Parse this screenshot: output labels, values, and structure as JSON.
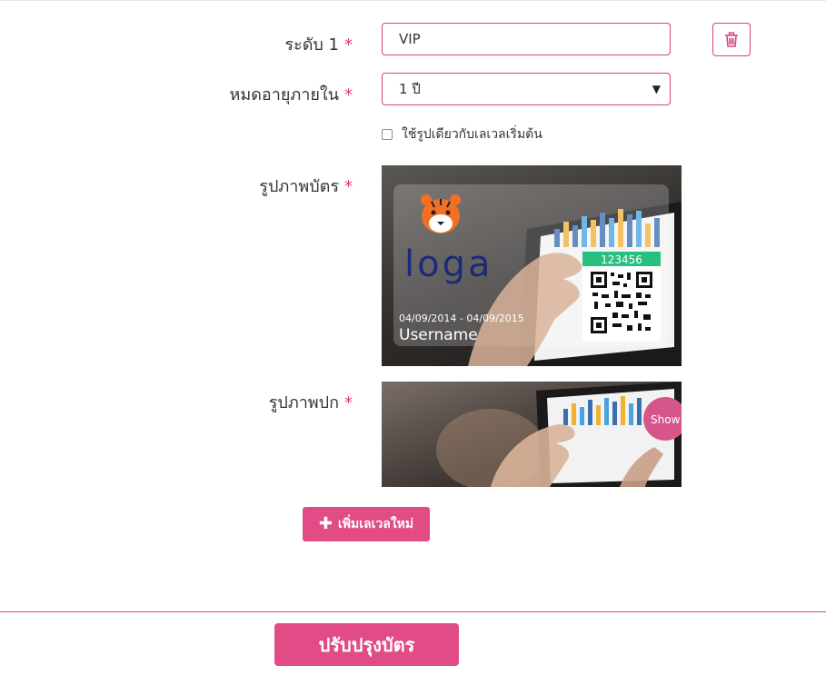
{
  "form": {
    "level": {
      "label": "ระดับ 1",
      "required_mark": "*",
      "value": "VIP"
    },
    "expiry": {
      "label": "หมดอายุภายใน",
      "required_mark": "*",
      "selected": "1 ปี"
    },
    "same_image_checkbox": {
      "label": "ใช้รูปเดียวกับเลเวลเริ่มต้น",
      "checked": false
    },
    "card_image": {
      "label": "รูปภาพบัตร",
      "required_mark": "*",
      "preview": {
        "brand": "loga",
        "member_code": "123456",
        "validity": "04/09/2014 - 04/09/2015",
        "username": "Username"
      }
    },
    "cover_image": {
      "label": "รูปภาพปก",
      "required_mark": "*",
      "tag": "Show"
    }
  },
  "actions": {
    "add_level_label": "เพิ่มเลเวลใหม่",
    "submit_label": "ปรับปรุงบัตร"
  },
  "icons": {
    "delete": "trash-icon",
    "add": "plus-icon",
    "dropdown": "caret-down-icon"
  },
  "colors": {
    "accent": "#e14c86",
    "border_accent": "#d4447f",
    "required": "#e23b6f",
    "code_bar": "#27c07f"
  }
}
